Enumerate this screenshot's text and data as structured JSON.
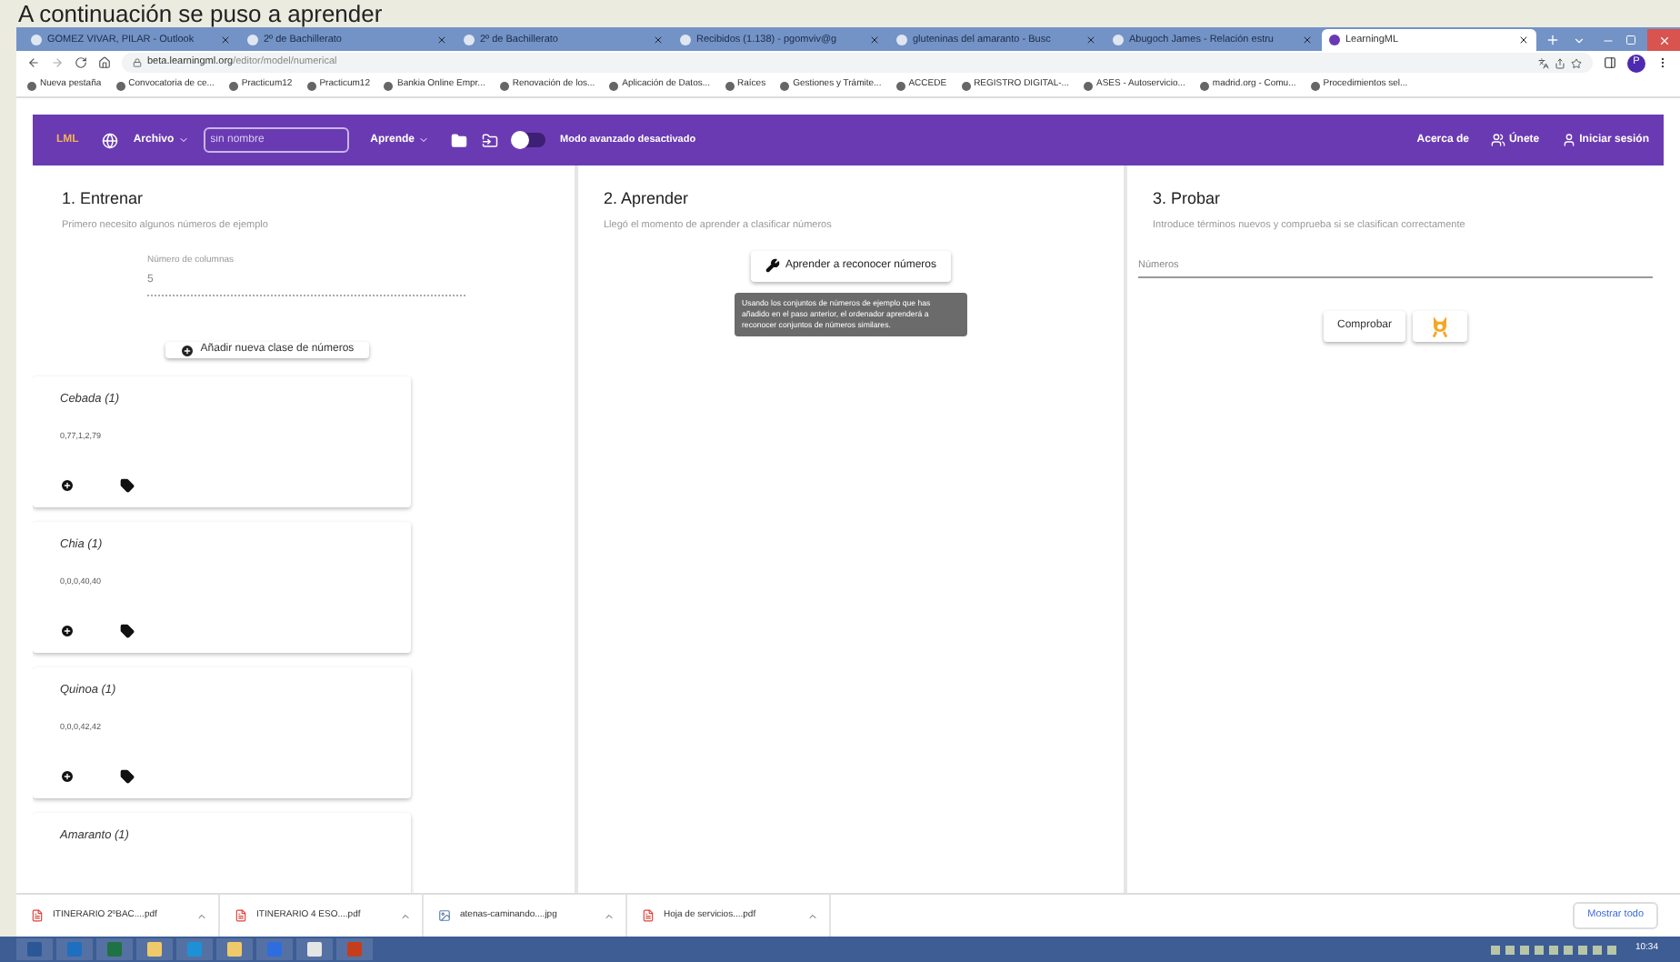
{
  "slide_title": "A continuación se puso a aprender",
  "tabs": [
    {
      "title": "GOMEZ VIVAR, PILAR - Outlook",
      "selected": false
    },
    {
      "title": "2º de Bachillerato",
      "selected": false
    },
    {
      "title": "2º de Bachillerato",
      "selected": false
    },
    {
      "title": "Recibidos (1.138) - pgomviv@g",
      "selected": false
    },
    {
      "title": "gluteninas del amaranto - Busc",
      "selected": false
    },
    {
      "title": "Abugoch James - Relación estru",
      "selected": false
    },
    {
      "title": "LearningML",
      "selected": true
    }
  ],
  "address": {
    "host": "beta.learningml.org",
    "path": "/editor/model/numerical"
  },
  "profile": "P",
  "bookmarks": [
    "Nueva pestaña",
    "Convocatoria de ce...",
    "Practicum12",
    "Practicum12",
    "Bankia Online Empr...",
    "Renovación de los...",
    "Aplicación de Datos...",
    "Raíces",
    "Gestiones y Trámite...",
    "ACCEDE",
    "REGISTRO DIGITAL-...",
    "ASES - Autoservicio...",
    "madrid.org - Comu...",
    "Procedimientos sel..."
  ],
  "appbar": {
    "logo": "LML",
    "file_menu": "Archivo",
    "project_name": {
      "placeholder": "sin nombre"
    },
    "learn_menu": "Aprende",
    "advanced_mode": {
      "on": false,
      "label": "Modo avanzado desactivado"
    },
    "about": "Acerca de",
    "join": "Únete",
    "login": "Iniciar sesión"
  },
  "train": {
    "title": "1. Entrenar",
    "subtitle": "Primero necesito algunos números de ejemplo",
    "columns_field": {
      "label": "Número de columnas",
      "value": "5"
    },
    "add_class": "Añadir nueva clase de números",
    "classes": [
      {
        "name": "Cebada (1)",
        "examples": "0,77,1,2,79"
      },
      {
        "name": "Chia (1)",
        "examples": "0,0,0,40,40"
      },
      {
        "name": "Quinoa (1)",
        "examples": "0,0,0,42,42"
      },
      {
        "name": "Amaranto (1)"
      }
    ]
  },
  "learn": {
    "title": "2. Aprender",
    "subtitle": "Llegó el momento de aprender a clasificar números",
    "button": "Aprender a reconocer números",
    "tooltip": "Usando los conjuntos de números de ejemplo que has añadido en el paso anterior, el ordenador aprenderá a reconocer conjuntos de números similares."
  },
  "test": {
    "title": "3. Probar",
    "subtitle": "Introduce términos nuevos y comprueba si se clasifican correctamente",
    "input": {
      "placeholder": "Números"
    },
    "check": "Comprobar"
  },
  "downloads": [
    "ITINERARIO 2ºBAC....pdf",
    "ITINERARIO 4 ESO....pdf",
    "atenas-caminando....jpg",
    "Hoja de servicios....pdf"
  ],
  "show_all": "Mostrar todo",
  "clock": "10:34"
}
